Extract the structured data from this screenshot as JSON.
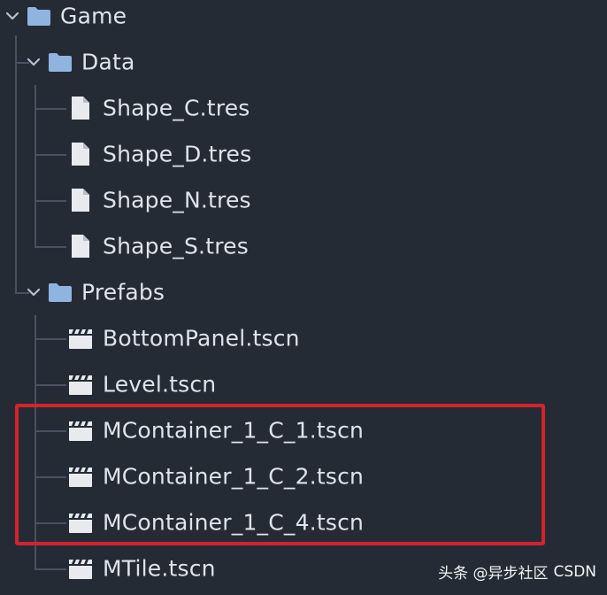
{
  "tree": {
    "root": {
      "label": "Game",
      "expanded": true
    },
    "data_folder": {
      "label": "Data",
      "expanded": true
    },
    "data_files": [
      "Shape_C.tres",
      "Shape_D.tres",
      "Shape_N.tres",
      "Shape_S.tres"
    ],
    "prefabs_folder": {
      "label": "Prefabs",
      "expanded": true
    },
    "prefab_files": [
      "BottomPanel.tscn",
      "Level.tscn",
      "MContainer_1_C_1.tscn",
      "MContainer_1_C_2.tscn",
      "MContainer_1_C_4.tscn",
      "MTile.tscn"
    ]
  },
  "watermark": {
    "text": "头条 @异步社区",
    "overlay": "CSDN"
  },
  "colors": {
    "background": "#252b35",
    "text": "#dfe3ea",
    "folder": "#8fb4e0",
    "file": "#e8eaee",
    "guide_line": "#4a5160",
    "highlight": "#d5232e"
  },
  "icons": {
    "folder": "folder-icon",
    "resource_file": "file-icon",
    "scene_file": "clapperboard-icon",
    "expand": "chevron-down-icon"
  }
}
